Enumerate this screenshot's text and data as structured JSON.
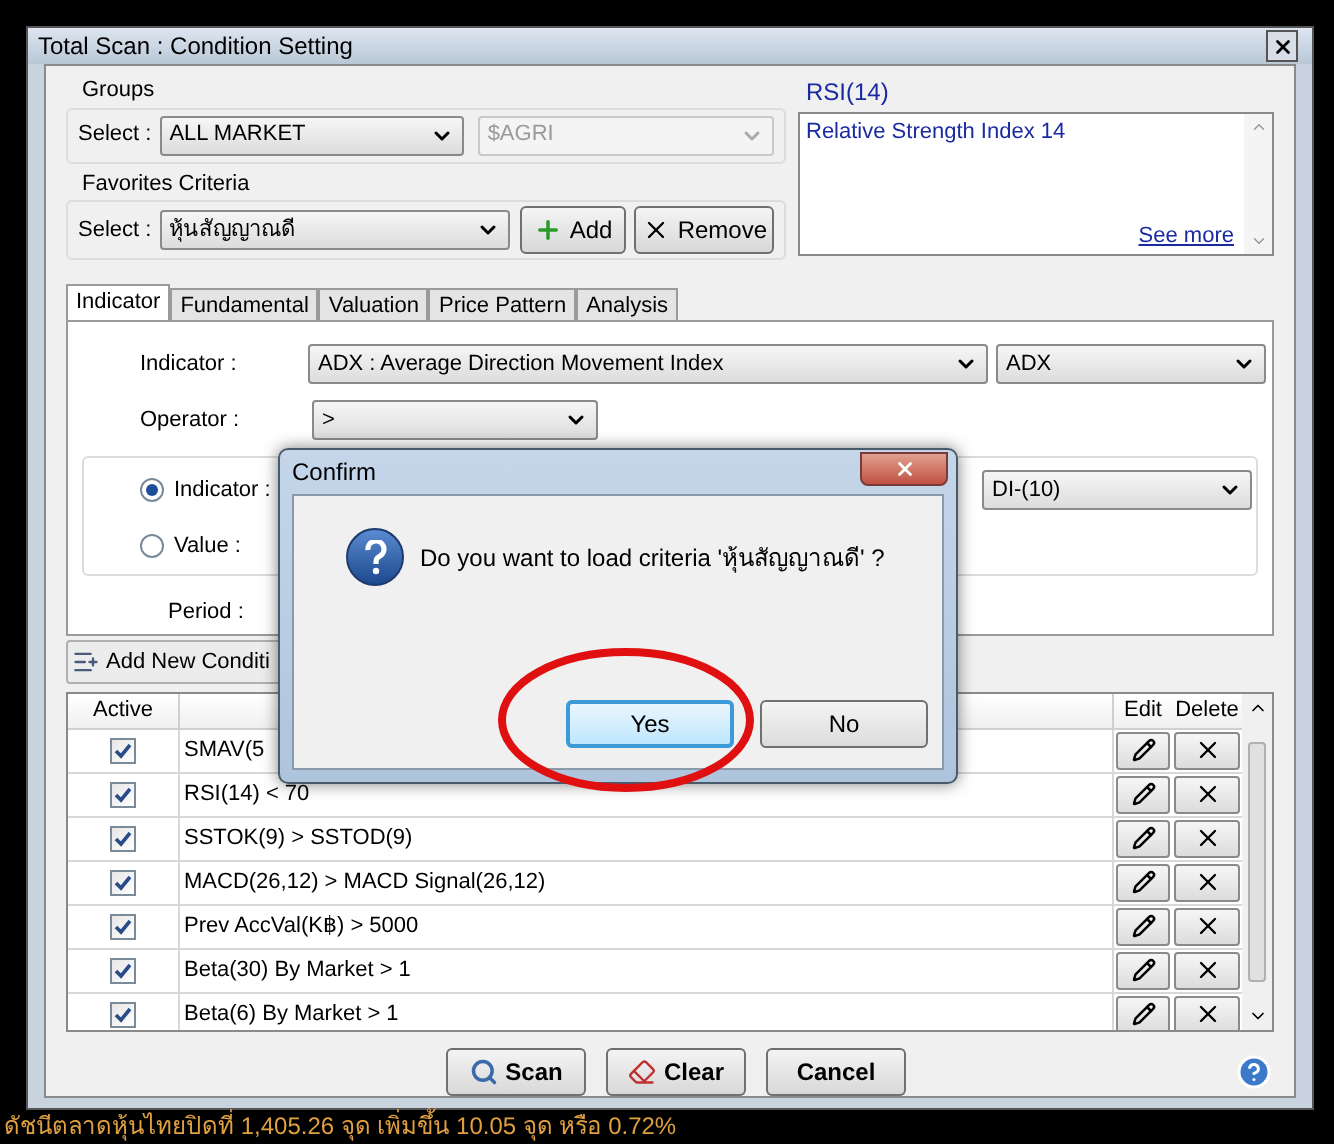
{
  "window": {
    "title": "Total Scan : Condition Setting"
  },
  "groups": {
    "label": "Groups",
    "select_label": "Select :",
    "market": "ALL MARKET",
    "sector": "$AGRI",
    "sector_disabled": true
  },
  "favorites": {
    "label": "Favorites Criteria",
    "select_label": "Select :",
    "value": "หุ้นสัญญาณดี",
    "add": "Add",
    "remove": "Remove"
  },
  "description": {
    "title": "RSI(14)",
    "text": "Relative Strength Index 14",
    "link": "See more"
  },
  "tabs": [
    {
      "label": "Indicator",
      "selected": true
    },
    {
      "label": "Fundamental",
      "selected": false
    },
    {
      "label": "Valuation",
      "selected": false
    },
    {
      "label": "Price Pattern",
      "selected": false
    },
    {
      "label": "Analysis",
      "selected": false
    }
  ],
  "indicator_panel": {
    "indicator_label": "Indicator :",
    "indicator": "ADX : Average Direction Movement Index",
    "indicator_short": "ADX",
    "operator_label": "Operator :",
    "operator": ">",
    "compare": [
      {
        "label": "Indicator :",
        "selected": true
      },
      {
        "label": "Value :",
        "selected": false
      }
    ],
    "compare_indicator": "DI-(10)",
    "period_label": "Period :"
  },
  "add_condition": "Add New Conditi",
  "table": {
    "columns": [
      "Active",
      "Edit",
      "Delete"
    ],
    "rows": [
      {
        "condition": "SMAV(5",
        "active": true
      },
      {
        "condition": "RSI(14) < 70",
        "active": true
      },
      {
        "condition": "SSTOK(9) > SSTOD(9)",
        "active": true
      },
      {
        "condition": "MACD(26,12) > MACD Signal(26,12)",
        "active": true
      },
      {
        "condition": "Prev AccVal(K฿) > 5000",
        "active": true
      },
      {
        "condition": "Beta(30) By Market > 1",
        "active": true
      },
      {
        "condition": "Beta(6) By Market > 1",
        "active": true
      }
    ]
  },
  "actions": [
    "Scan",
    "Clear",
    "Cancel"
  ],
  "confirm": {
    "title": "Confirm",
    "message": "Do you want to load criteria 'หุ้นสัญญาณดี' ?",
    "buttons": [
      {
        "label": "Yes",
        "selected": true
      },
      {
        "label": "No",
        "selected": false
      }
    ]
  },
  "ticker": "ดัชนีตลาดหุ้นไทยปิดที่ 1,405.26 จุด เพิ่มขึ้น 10.05 จุด หรือ 0.72%"
}
